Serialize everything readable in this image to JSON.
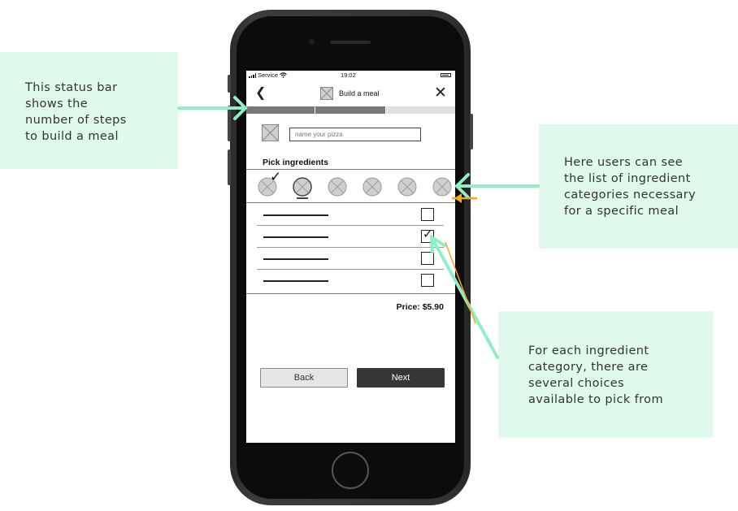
{
  "annotations": {
    "left": "This status bar\nshows the\nnumber of steps\nto build a meal",
    "right_top": "Here users can see\nthe list of ingredient\ncategories necessary\nfor a specific meal",
    "right_bottom": "For each ingredient\ncategory, there are\nseveral choices\navailable to pick from"
  },
  "colors": {
    "note_bg": "#dff9ec",
    "arrow": "#8ef0c4",
    "accent_orange": "#f5a623",
    "progress_done": "#777777",
    "progress_todo": "#e0e0e0"
  },
  "status_bar": {
    "carrier": "Service",
    "time": "19:02"
  },
  "header": {
    "back_icon": "chevron-left-icon",
    "title": "Build a meal",
    "close_icon": "close-icon"
  },
  "progress": {
    "total_steps": 3,
    "current_step": 2
  },
  "name_field": {
    "placeholder": "name your pizza",
    "value": ""
  },
  "ingredients": {
    "title": "Pick ingredients",
    "categories": [
      {
        "icon": "image-placeholder-icon",
        "completed": true,
        "selected": false
      },
      {
        "icon": "image-placeholder-icon",
        "completed": false,
        "selected": true
      },
      {
        "icon": "image-placeholder-icon",
        "completed": false,
        "selected": false
      },
      {
        "icon": "image-placeholder-icon",
        "completed": false,
        "selected": false
      },
      {
        "icon": "image-placeholder-icon",
        "completed": false,
        "selected": false
      },
      {
        "icon": "image-placeholder-icon",
        "completed": false,
        "selected": false
      }
    ],
    "options": [
      {
        "checked": false
      },
      {
        "checked": true
      },
      {
        "checked": false
      },
      {
        "checked": false
      }
    ]
  },
  "price": "Price: $5.90",
  "buttons": {
    "back": "Back",
    "next": "Next"
  }
}
